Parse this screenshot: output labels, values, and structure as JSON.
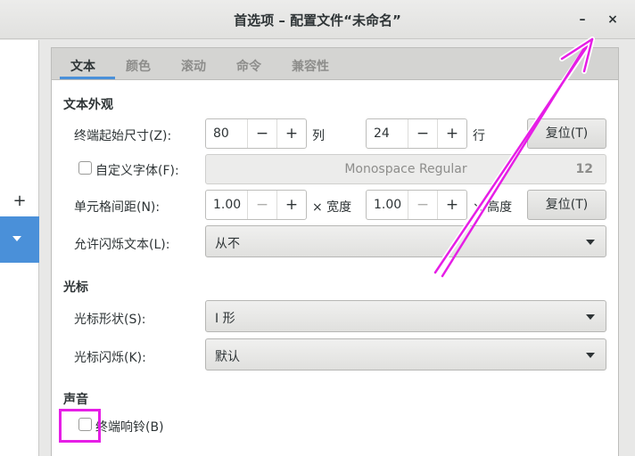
{
  "window": {
    "title": "首选项 – 配置文件“未命名”",
    "minimize_glyph": "–",
    "close_glyph": "×"
  },
  "sidebar": {
    "add_glyph": "+"
  },
  "tabs": [
    "文本",
    "颜色",
    "滚动",
    "命令",
    "兼容性"
  ],
  "active_tab": "文本",
  "text_appearance": {
    "section_title": "文本外观",
    "initial_size_label": "终端起始尺寸(Z):",
    "columns_value": "80",
    "columns_unit": "列",
    "rows_value": "24",
    "rows_unit": "行",
    "reset_size_label": "复位(T)",
    "custom_font_label": "自定义字体(F):",
    "custom_font_checked": false,
    "font_name": "Monospace Regular",
    "font_size": "12",
    "spacing_label": "单元格间距(N):",
    "width_spacing_value": "1.00",
    "width_unit": "× 宽度",
    "height_spacing_value": "1.00",
    "height_unit": "× 高度",
    "reset_spacing_label": "复位(T)",
    "blink_text_label": "允许闪烁文本(L):",
    "blink_text_value": "从不"
  },
  "cursor": {
    "section_title": "光标",
    "shape_label": "光标形状(S):",
    "shape_value": "I 形",
    "blink_label": "光标闪烁(K):",
    "blink_value": "默认"
  },
  "sound": {
    "section_title": "声音",
    "terminal_bell_label": "终端响铃(B)",
    "terminal_bell_checked": false
  },
  "spin_glyphs": {
    "minus": "−",
    "plus": "+"
  },
  "annotation": {
    "color": "#e61ee6"
  }
}
